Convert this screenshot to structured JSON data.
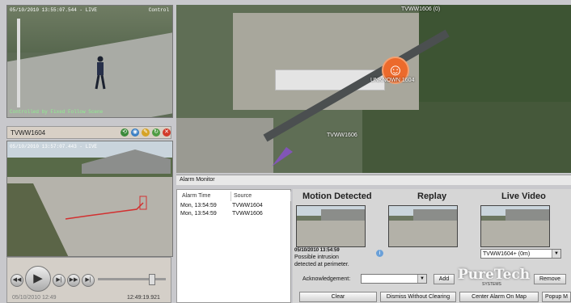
{
  "camera1": {
    "timestamp": "05/10/2010 13:55:07.544 - LIVE",
    "mode": "Control",
    "footer": "Controlled by Fixed Follow Scene"
  },
  "camera2": {
    "title": "TVWW1604",
    "timestamp": "05/10/2010 13:57:07.443 - LIVE"
  },
  "player": {
    "time_left": "05/10/2010 12:49",
    "time_right": "12:49:19.921",
    "slider_fraction": 0.78
  },
  "map": {
    "top_label": "TVWW1606 (0)",
    "marker_label": "UNKNOWN 1604",
    "camera_label": "TVWW1606"
  },
  "alarm_monitor": {
    "title": "Alarm Monitor",
    "columns": [
      "Alarm Time",
      "Source"
    ],
    "rows": [
      {
        "time": "Mon, 13:54:59",
        "source": "TVWW1604"
      },
      {
        "time": "Mon, 13:54:59",
        "source": "TVWW1606"
      }
    ],
    "headers": {
      "motion": "Motion Detected",
      "replay": "Replay",
      "live": "Live Video"
    },
    "event_time": "05/10/2010 13:54:59",
    "description_line1": "Possible intrusion",
    "description_line2": "detected at perimeter.",
    "camera_select": "TVWW1604+ (0m)",
    "ack_label": "Acknowledgement:",
    "add_button": "Add",
    "remove_button": "Remove",
    "buttons": {
      "clear": "Clear",
      "dismiss": "Dismiss Without Clearing",
      "center": "Center Alarm On Map",
      "popup": "Popup M"
    },
    "watermark": "PureTech",
    "watermark_sub": "SYSTEMS"
  }
}
